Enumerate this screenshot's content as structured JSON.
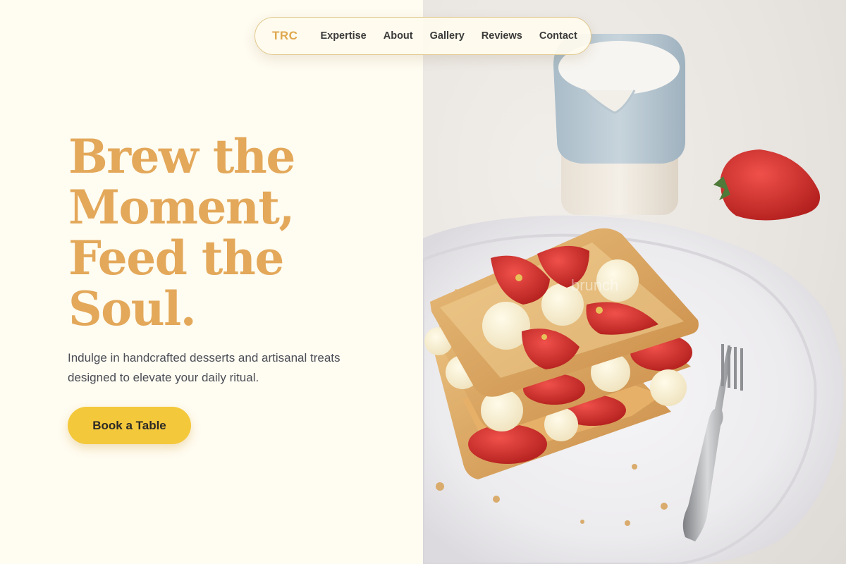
{
  "nav": {
    "brand": "TRC",
    "links": [
      "Expertise",
      "About",
      "Gallery",
      "Reviews",
      "Contact"
    ]
  },
  "hero": {
    "title_lines": [
      "Brew the",
      "Moment,",
      "Feed the",
      "Soul."
    ],
    "subtitle": "Indulge in handcrafted desserts and artisanal treats designed to elevate your daily ritual.",
    "cta_label": "Book a Table"
  },
  "photo": {
    "subject": "strawberry mille-feuille on white plate with fork, milk jug and strawberry",
    "watermark": "brunch"
  },
  "colors": {
    "background": "#fffcf1",
    "accent_title": "#e3a85a",
    "brand": "#dfa74e",
    "cta": "#f4c83b",
    "text": "#4a4d55"
  }
}
